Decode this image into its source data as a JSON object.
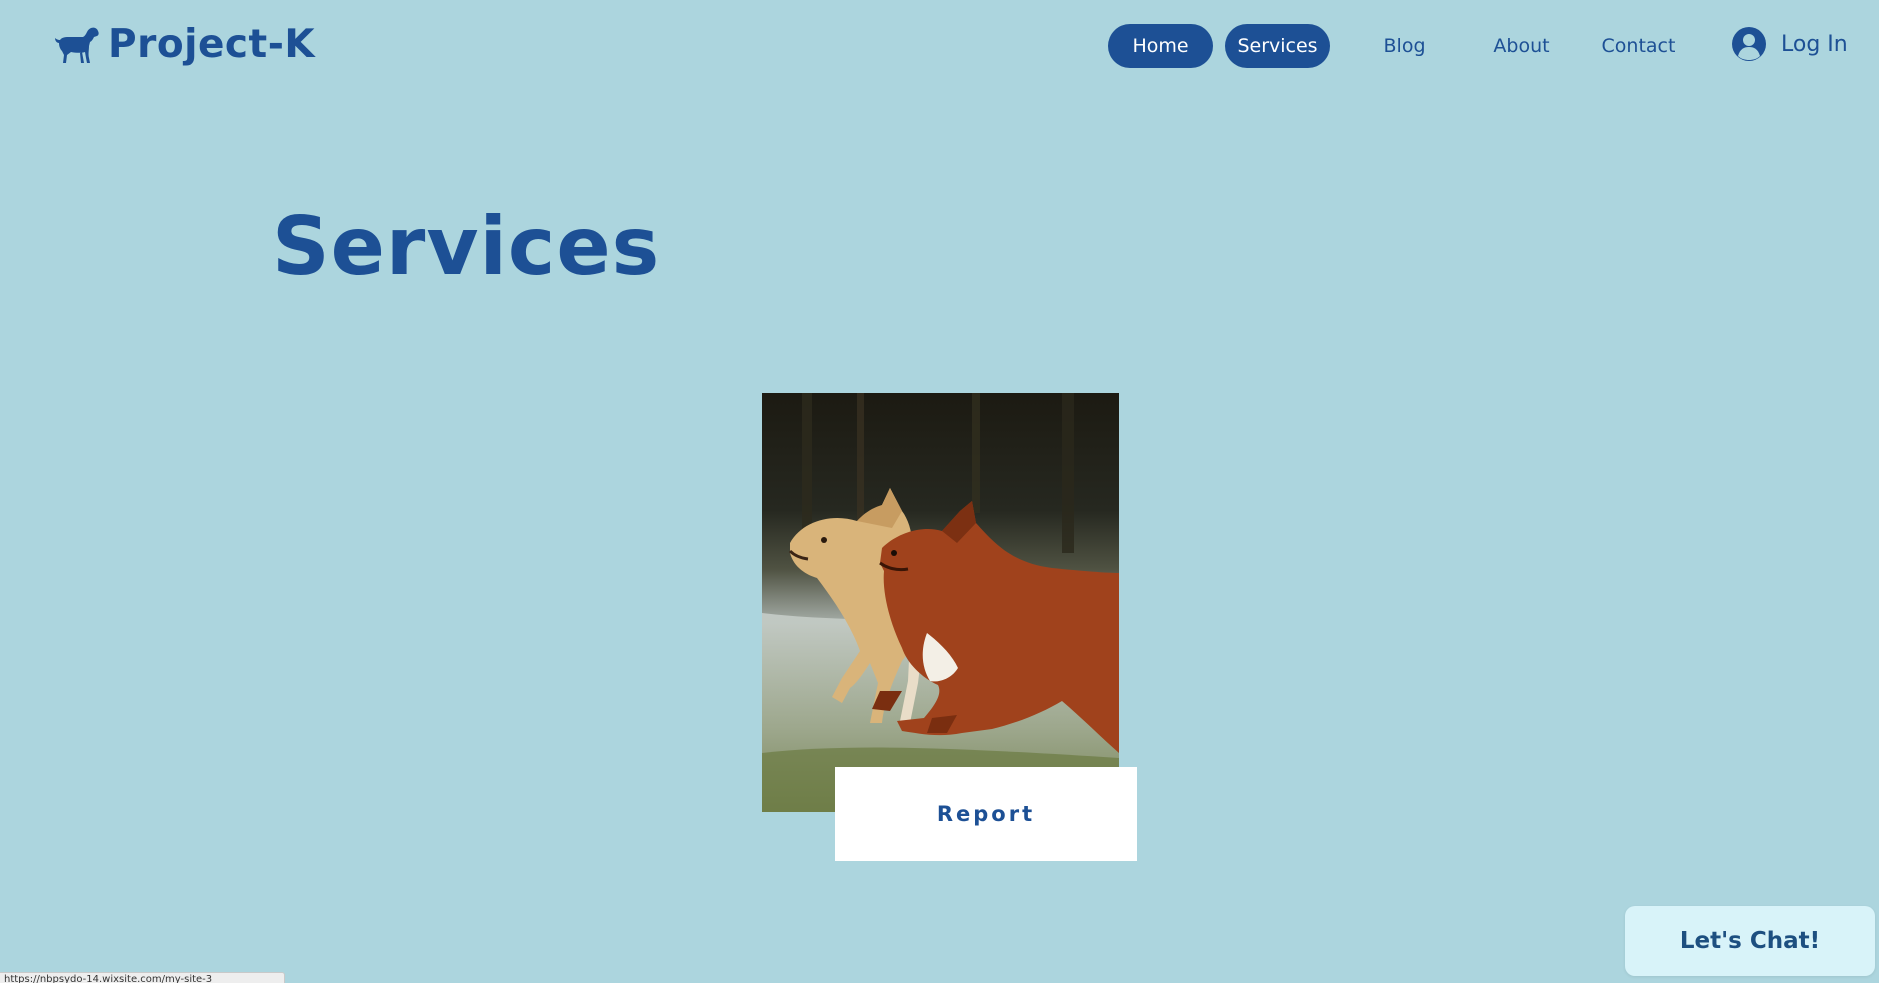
{
  "header": {
    "logo_text": "Project-K",
    "logo_icon": "dog-silhouette-icon",
    "nav": [
      {
        "label": "Home",
        "style": "pill"
      },
      {
        "label": "Services",
        "style": "pill"
      },
      {
        "label": "Blog",
        "style": "plain"
      },
      {
        "label": "About",
        "style": "plain"
      },
      {
        "label": "Contact",
        "style": "plain"
      }
    ],
    "login_label": "Log In",
    "login_icon": "user-avatar-icon"
  },
  "main": {
    "title": "Services",
    "cards": [
      {
        "image": "running-dogs-photo",
        "label": "Report"
      }
    ]
  },
  "chat": {
    "label": "Let's Chat!"
  },
  "status_url": "https://nbpsydo-14.wixsite.com/my-site-3",
  "colors": {
    "background": "#acd5de",
    "brand": "#1d5095",
    "pill_text": "#ffffff",
    "card_label_bg": "#ffffff",
    "chat_bg": "#d8f3f9"
  }
}
